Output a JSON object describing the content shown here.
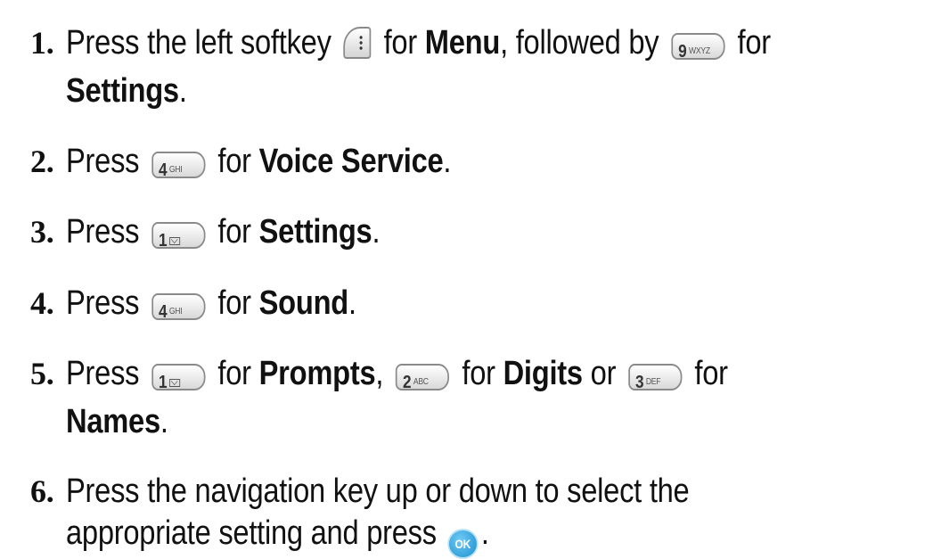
{
  "steps": [
    {
      "number": "1.",
      "t1": "Press the left softkey",
      "t2": "for",
      "t3": "Menu",
      "t4": ", followed by",
      "t5": "for",
      "t6": "Settings",
      "t7": "."
    },
    {
      "number": "2.",
      "t1": "Press",
      "t2": "for",
      "t3": "Voice Service",
      "t4": "."
    },
    {
      "number": "3.",
      "t1": "Press",
      "t2": "for",
      "t3": "Settings",
      "t4": "."
    },
    {
      "number": "4.",
      "t1": "Press",
      "t2": "for",
      "t3": "Sound",
      "t4": "."
    },
    {
      "number": "5.",
      "t1": "Press",
      "t2": "for",
      "t3": "Prompts",
      "t4": ",",
      "t5": "for",
      "t6": "Digits",
      "t7": "or",
      "t8": "for",
      "t9": "Names",
      "t10": "."
    },
    {
      "number": "6.",
      "t1": "Press the navigation key up or down to select the",
      "t2": "appropriate setting and press",
      "t3": "."
    }
  ],
  "keys": {
    "k9": {
      "digit": "9",
      "letters": "WXYZ"
    },
    "k4": {
      "digit": "4",
      "letters": "GHI"
    },
    "k1": {
      "digit": "1"
    },
    "k2": {
      "digit": "2",
      "letters": "ABC"
    },
    "k3": {
      "digit": "3",
      "letters": "DEF"
    },
    "ok": {
      "label": "OK"
    }
  },
  "icons": {
    "softkey": "left-softkey-icon",
    "envelope": "envelope-icon",
    "ok": "ok-button-icon"
  },
  "colors": {
    "text": "#111111",
    "ok_button": "#1a8fd0"
  }
}
